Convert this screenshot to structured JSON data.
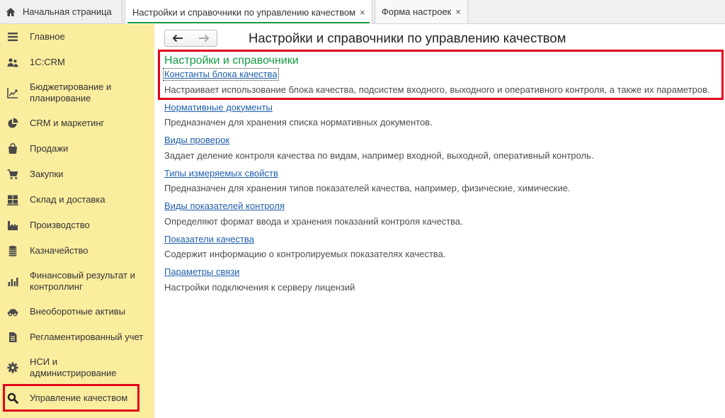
{
  "tabs": [
    {
      "label": "Начальная страница",
      "icon": "home-icon",
      "active": false
    },
    {
      "label": "Настройки и справочники по управлению качеством",
      "close_label": "×",
      "active": true
    },
    {
      "label": "Форма настроек",
      "close_label": "×",
      "active": false
    }
  ],
  "sidebar": {
    "selected_index": 13,
    "items": [
      {
        "label": "Главное",
        "icon": "menu-icon"
      },
      {
        "label": "1С:CRM",
        "icon": "people-icon"
      },
      {
        "label": "Бюджетирование и\nпланирование",
        "icon": "trend-chart-icon"
      },
      {
        "label": "CRM и маркетинг",
        "icon": "pie-chart-icon"
      },
      {
        "label": "Продажи",
        "icon": "shopping-bag-icon"
      },
      {
        "label": "Закупки",
        "icon": "shopping-cart-icon"
      },
      {
        "label": "Склад и доставка",
        "icon": "warehouse-icon"
      },
      {
        "label": "Производство",
        "icon": "factory-icon"
      },
      {
        "label": "Казначейство",
        "icon": "coins-icon"
      },
      {
        "label": "Финансовый результат и\nконтроллинг",
        "icon": "bar-chart-icon"
      },
      {
        "label": "Внеоборотные активы",
        "icon": "car-icon"
      },
      {
        "label": "Регламентированный учет",
        "icon": "document-icon"
      },
      {
        "label": "НСИ и\nадминистрирование",
        "icon": "gear-icon"
      },
      {
        "label": "Управление качеством",
        "icon": "search-icon"
      }
    ]
  },
  "navigation": {
    "back_icon": "arrow-left-icon",
    "forward_icon": "arrow-right-icon",
    "back_enabled": true,
    "forward_enabled": false
  },
  "page": {
    "title": "Настройки и справочники по управлению качеством"
  },
  "section": {
    "heading": "Настройки и справочники",
    "items": [
      {
        "link": "Константы блока качества",
        "description": "Настраивает использование блока качества, подсистем входного, выходного и оперативного контроля, а также их параметров.",
        "focused": true
      },
      {
        "link": "Нормативные документы",
        "description": "Предназначен для хранения списка нормативных документов."
      },
      {
        "link": "Виды проверок",
        "description": "Задает деление контроля качества по видам, например входной, выходной, оперативный контроль."
      },
      {
        "link": "Типы измеряемых свойств",
        "description": "Предназначен для хранения типов показателей качества, например, физические, химические."
      },
      {
        "link": "Виды показателей контроля",
        "description": "Определяют формат ввода и хранения показаний контроля качества."
      },
      {
        "link": "Показатели качества",
        "description": "Содержит информацию о контролируемых показателях качества."
      },
      {
        "link": "Параметры связи",
        "description": "Настройки подключения к серверу лицензий"
      }
    ]
  },
  "colors": {
    "sidebar_background": "#fbed9e",
    "accent_green": "#139c43",
    "link_blue": "#1f5fad",
    "highlight_red": "#e2001a",
    "description_text": "#4d4d4d"
  }
}
